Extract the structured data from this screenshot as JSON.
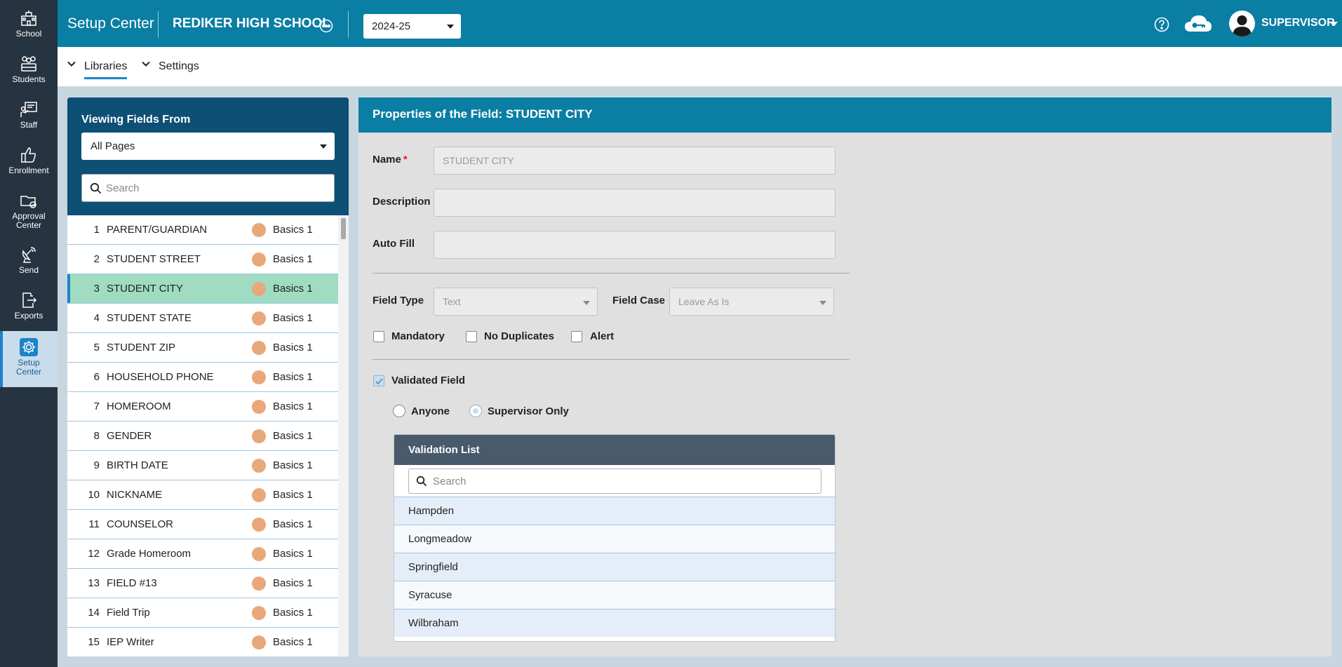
{
  "rail": {
    "items": [
      {
        "label": "School"
      },
      {
        "label": "Students"
      },
      {
        "label": "Staff"
      },
      {
        "label": "Enrollment"
      },
      {
        "label_line1": "Approval",
        "label_line2": "Center"
      },
      {
        "label": "Send"
      },
      {
        "label": "Exports"
      },
      {
        "label_line1": "Setup",
        "label_line2": "Center"
      }
    ]
  },
  "topbar": {
    "app_title": "Setup Center",
    "school_name": "REDIKER HIGH SCHOOL",
    "year": "2024-25",
    "user_name": "SUPERVISOR"
  },
  "subnav": {
    "libraries": "Libraries",
    "settings": "Settings"
  },
  "left_panel": {
    "title": "Viewing Fields From",
    "pages_value": "All Pages",
    "search_placeholder": "Search",
    "fields": [
      {
        "num": "1",
        "name": "PARENT/GUARDIAN",
        "page": "Basics 1"
      },
      {
        "num": "2",
        "name": "STUDENT STREET",
        "page": "Basics 1"
      },
      {
        "num": "3",
        "name": "STUDENT CITY",
        "page": "Basics 1"
      },
      {
        "num": "4",
        "name": "STUDENT STATE",
        "page": "Basics 1"
      },
      {
        "num": "5",
        "name": "STUDENT ZIP",
        "page": "Basics 1"
      },
      {
        "num": "6",
        "name": "HOUSEHOLD PHONE",
        "page": "Basics 1"
      },
      {
        "num": "7",
        "name": "HOMEROOM",
        "page": "Basics 1"
      },
      {
        "num": "8",
        "name": "GENDER",
        "page": "Basics 1"
      },
      {
        "num": "9",
        "name": "BIRTH DATE",
        "page": "Basics 1"
      },
      {
        "num": "10",
        "name": "NICKNAME",
        "page": "Basics 1"
      },
      {
        "num": "11",
        "name": "COUNSELOR",
        "page": "Basics 1"
      },
      {
        "num": "12",
        "name": "Grade Homeroom",
        "page": "Basics 1"
      },
      {
        "num": "13",
        "name": "FIELD #13",
        "page": "Basics 1"
      },
      {
        "num": "14",
        "name": "Field Trip",
        "page": "Basics 1"
      },
      {
        "num": "15",
        "name": "IEP Writer",
        "page": "Basics 1"
      }
    ]
  },
  "properties": {
    "title": "Properties of the Field: STUDENT CITY",
    "name_label": "Name",
    "required_mark": "*",
    "name_value": "STUDENT CITY",
    "description_label": "Description",
    "description_value": "",
    "autofill_label": "Auto Fill",
    "autofill_value": "",
    "field_type_label": "Field Type",
    "field_type_value": "Text",
    "field_case_label": "Field Case",
    "field_case_value": "Leave As Is",
    "mandatory_label": "Mandatory",
    "no_duplicates_label": "No Duplicates",
    "alert_label": "Alert",
    "validated_label": "Validated Field",
    "anyone_label": "Anyone",
    "supervisor_only_label": "Supervisor Only"
  },
  "validation": {
    "title": "Validation List",
    "search_placeholder": "Search",
    "items": [
      "Hampden",
      "Longmeadow",
      "Springfield",
      "Syracuse",
      "Wilbraham"
    ]
  },
  "colors": {
    "topbar": "#0a7ea3",
    "rail": "#263340",
    "selected_row": "#9fdcc2",
    "page_dot": "#e8a879",
    "accent": "#1b84c6"
  }
}
